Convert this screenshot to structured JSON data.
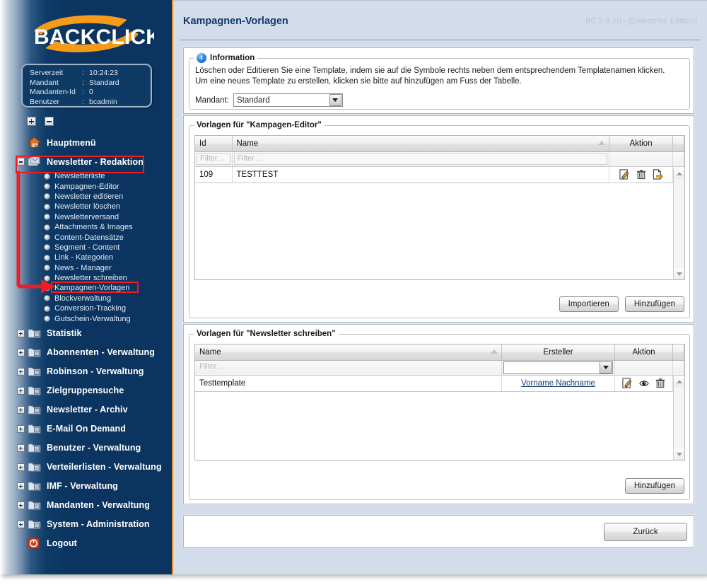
{
  "brand": {
    "logo_text": "BACKCLICK"
  },
  "serverinfo": {
    "rows": [
      {
        "key": "Serverzeit",
        "value": "10:24:23"
      },
      {
        "key": "Mandant",
        "value": "Standard"
      },
      {
        "key": "Mandanten-Id",
        "value": "0"
      },
      {
        "key": "Benutzer",
        "value": "bcadmin"
      }
    ]
  },
  "sidebar": {
    "items": [
      {
        "label": "Hauptmenü",
        "icon": "house-icon",
        "toggle": "none",
        "expanded": false
      },
      {
        "label": "Newsletter - Redaktion",
        "icon": "newsletter-icon",
        "toggle": "minus",
        "expanded": true,
        "children": [
          "Newsletterliste",
          "Kampagnen-Editor",
          "Newsletter editieren",
          "Newsletter löschen",
          "Newsletterversand",
          "Attachments & Images",
          "Content-Datensätze",
          "Segment - Content",
          "Link - Kategorien",
          "News - Manager",
          "Newsletter schreiben",
          "Kampagnen-Vorlagen",
          "Blockverwaltung",
          "Conversion-Tracking",
          "Gutschein-Verwaltung"
        ]
      },
      {
        "label": "Statistik",
        "icon": "folder-icon",
        "toggle": "plus",
        "expanded": false
      },
      {
        "label": "Abonnenten - Verwaltung",
        "icon": "folder-icon",
        "toggle": "plus",
        "expanded": false
      },
      {
        "label": "Robinson - Verwaltung",
        "icon": "folder-icon",
        "toggle": "plus",
        "expanded": false
      },
      {
        "label": "Zielgruppensuche",
        "icon": "folder-icon",
        "toggle": "plus",
        "expanded": false
      },
      {
        "label": "Newsletter - Archiv",
        "icon": "folder-icon",
        "toggle": "plus",
        "expanded": false
      },
      {
        "label": "E-Mail On Demand",
        "icon": "folder-icon",
        "toggle": "plus",
        "expanded": false
      },
      {
        "label": "Benutzer - Verwaltung",
        "icon": "folder-icon",
        "toggle": "plus",
        "expanded": false
      },
      {
        "label": "Verteilerlisten - Verwaltung",
        "icon": "folder-icon",
        "toggle": "plus",
        "expanded": false
      },
      {
        "label": "IMF - Verwaltung",
        "icon": "folder-icon",
        "toggle": "plus",
        "expanded": false
      },
      {
        "label": "Mandanten - Verwaltung",
        "icon": "folder-icon",
        "toggle": "plus",
        "expanded": false
      },
      {
        "label": "System - Administration",
        "icon": "folder-icon",
        "toggle": "plus",
        "expanded": false
      },
      {
        "label": "Logout",
        "icon": "logout-icon",
        "toggle": "none",
        "expanded": false
      }
    ],
    "highlighted_top": "Newsletter - Redaktion",
    "highlighted_sub": "Kampagnen-Vorlagen"
  },
  "header": {
    "title": "Kampagnen-Vorlagen",
    "version": "BC 5.9.10 - [Enterprise Edition]"
  },
  "information": {
    "legend": "Information",
    "icon": "info-icon",
    "line1": "Löschen oder Editieren Sie eine Template, indem sie auf die Symbole rechts neben dem entsprechendem Templatenamen klicken.",
    "line2": "Um eine neues Template zu erstellen, klicken sie bitte auf hinzufügen am Fuss der Tabelle.",
    "mandant_label": "Mandant:",
    "mandant_value": "Standard"
  },
  "table_campaign": {
    "legend": "Vorlagen für \"Kampagen-Editor\"",
    "columns": [
      "Id",
      "Name",
      "Aktion"
    ],
    "sorted_column": "Name",
    "sort_dir": "asc",
    "filters": {
      "id": "Filter…",
      "name": "Filter…"
    },
    "rows": [
      {
        "id": "109",
        "name": "TESTTEST",
        "actions": [
          "edit-icon",
          "delete-icon",
          "export-icon"
        ]
      }
    ],
    "buttons": {
      "import": "Importieren",
      "add": "Hinzufügen"
    }
  },
  "table_newsletter": {
    "legend": "Vorlagen für \"Newsletter schreiben\"",
    "columns": [
      "Name",
      "Ersteller",
      "Aktion"
    ],
    "sorted_column": "Name",
    "sort_dir": "asc",
    "filters": {
      "name": "Filter…",
      "ersteller": ""
    },
    "rows": [
      {
        "name": "Testtemplate",
        "ersteller": "Vorname Nachname",
        "actions": [
          "edit-icon",
          "preview-icon",
          "delete-icon"
        ]
      }
    ],
    "buttons": {
      "add": "Hinzufügen"
    }
  },
  "footer": {
    "back": "Zurück"
  },
  "colors": {
    "sidebar_dark": "#0b3560",
    "sidebar_accent": "#e8931f",
    "title_blue": "#12386b",
    "annotation_red": "#ee1c25",
    "main_bg": "#d3dceb"
  }
}
